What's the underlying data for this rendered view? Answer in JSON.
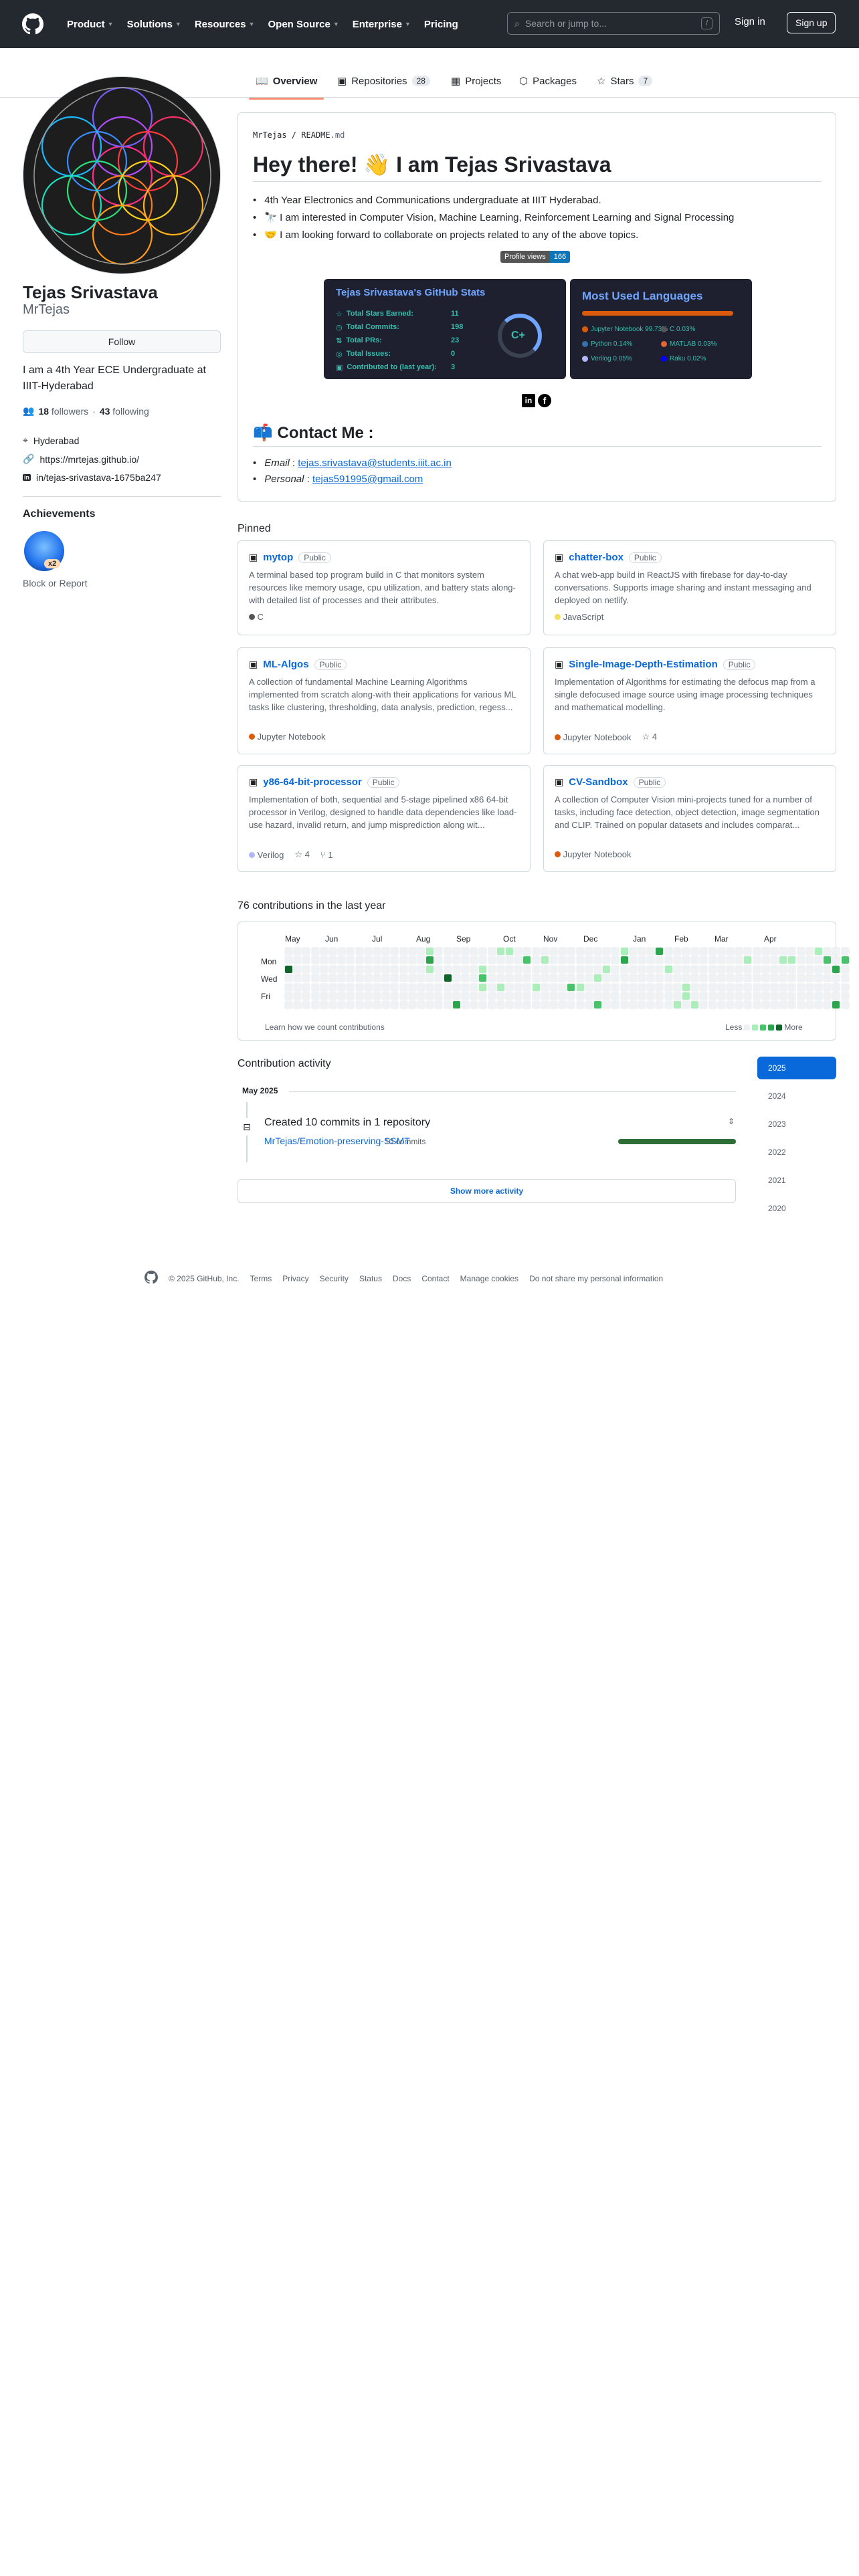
{
  "header": {
    "nav": [
      "Product",
      "Solutions",
      "Resources",
      "Open Source",
      "Enterprise",
      "Pricing"
    ],
    "search_placeholder": "Search or jump to...",
    "search_shortcut": "/",
    "signin": "Sign in",
    "signup": "Sign up"
  },
  "tabs": [
    {
      "label": "Overview",
      "icon": "book-icon"
    },
    {
      "label": "Repositories",
      "count": "28",
      "icon": "repo-icon"
    },
    {
      "label": "Projects",
      "icon": "table-icon"
    },
    {
      "label": "Packages",
      "icon": "package-icon"
    },
    {
      "label": "Stars",
      "count": "7",
      "icon": "star-icon"
    }
  ],
  "profile": {
    "name": "Tejas Srivastava",
    "login": "MrTejas",
    "follow": "Follow",
    "bio": "I am a 4th Year ECE Undergraduate at IIIT-Hyderabad",
    "followers": "18",
    "followers_label": "followers",
    "following": "43",
    "following_label": "following",
    "location": "Hyderabad",
    "website": "https://mrtejas.github.io/",
    "linkedin": "in/tejas-srivastava-1675ba247",
    "achievements_title": "Achievements",
    "achievement_count": "x2",
    "block": "Block or Report"
  },
  "readme": {
    "path_user": "MrTejas",
    "path_file": "README",
    "path_ext": ".md",
    "title": "Hey there! 👋 I am Tejas Srivastava",
    "bullets": [
      "4th Year Electronics and Communications undergraduate at IIIT Hyderabad.",
      "🔭 I am interested in Computer Vision, Machine Learning, Reinforcement Learning and Signal Processing",
      "🤝 I am looking forward to collaborate on projects related to any of the above topics."
    ],
    "profile_views_label": "Profile views",
    "profile_views": "166",
    "stats": {
      "title": "Tejas Srivastava's GitHub Stats",
      "rows": [
        {
          "label": "Total Stars Earned:",
          "value": "11"
        },
        {
          "label": "Total Commits:",
          "value": "198"
        },
        {
          "label": "Total PRs:",
          "value": "23"
        },
        {
          "label": "Total Issues:",
          "value": "0"
        },
        {
          "label": "Contributed to (last year):",
          "value": "3"
        }
      ],
      "grade": "C+"
    },
    "langs": {
      "title": "Most Used Languages",
      "items": [
        {
          "name": "Jupyter Notebook 99.73%",
          "color": "#DA5B0B"
        },
        {
          "name": "C 0.03%",
          "color": "#555555"
        },
        {
          "name": "Python 0.14%",
          "color": "#3572A5"
        },
        {
          "name": "MATLAB 0.03%",
          "color": "#e16737"
        },
        {
          "name": "Verilog 0.05%",
          "color": "#b2b7f8"
        },
        {
          "name": "Raku 0.02%",
          "color": "#0000fb"
        }
      ]
    },
    "contact_title": "📫 Contact Me :",
    "email_label": "Email",
    "email": "tejas.srivastava@students.iiit.ac.in",
    "personal_label": "Personal",
    "personal": "tejas591995@gmail.com"
  },
  "pinned": {
    "title": "Pinned",
    "public": "Public",
    "repos": [
      {
        "name": "mytop",
        "desc": "A terminal based top program build in C that monitors system resources like memory usage, cpu utilization, and battery stats along-with detailed list of processes and their attributes.",
        "lang": "C",
        "color": "#555555",
        "stars": "",
        "forks": ""
      },
      {
        "name": "chatter-box",
        "desc": "A chat web-app build in ReactJS with firebase for day-to-day conversations. Supports image sharing and instant messaging and deployed on netlify.",
        "lang": "JavaScript",
        "color": "#f1e05a",
        "stars": "",
        "forks": ""
      },
      {
        "name": "ML-Algos",
        "desc": "A collection of fundamental Machine Learning Algorithms implemented from scratch along-with their applications for various ML tasks like clustering, thresholding, data analysis, prediction, regess...",
        "lang": "Jupyter Notebook",
        "color": "#DA5B0B",
        "stars": "",
        "forks": ""
      },
      {
        "name": "Single-Image-Depth-Estimation",
        "desc": "Implementation of Algorithms for estimating the defocus map from a single defocused image source using image processing techniques and mathematical modelling.",
        "lang": "Jupyter Notebook",
        "color": "#DA5B0B",
        "stars": "4",
        "forks": ""
      },
      {
        "name": "y86-64-bit-processor",
        "desc": "Implementation of both, sequential and 5-stage pipelined x86 64-bit processor in Verilog, designed to handle data dependencies like load-use hazard, invalid return, and jump misprediction along wit...",
        "lang": "Verilog",
        "color": "#b2b7f8",
        "stars": "4",
        "forks": "1"
      },
      {
        "name": "CV-Sandbox",
        "desc": "A collection of Computer Vision mini-projects tuned for a number of tasks, including face detection, object detection, image segmentation and CLIP. Trained on popular datasets and includes comparat...",
        "lang": "Jupyter Notebook",
        "color": "#DA5B0B",
        "stars": "",
        "forks": ""
      }
    ]
  },
  "contributions": {
    "title": "76 contributions in the last year",
    "months": [
      "May",
      "Jun",
      "Jul",
      "Aug",
      "Sep",
      "Oct",
      "Nov",
      "Dec",
      "Jan",
      "Feb",
      "Mar",
      "Apr"
    ],
    "days": [
      "Mon",
      "Wed",
      "Fri"
    ],
    "learn": "Learn how we count contributions",
    "less": "Less",
    "more": "More",
    "colors": [
      "#eff2f5",
      "#aceebb",
      "#4ac26b",
      "#2da44e",
      "#116329"
    ]
  },
  "activity": {
    "title": "Contribution activity",
    "month": "May 2025",
    "event_title": "Created 10 commits in 1 repository",
    "repo": "MrTejas/Emotion-preserving-SSMT",
    "commits": "10 commits",
    "show_more": "Show more activity",
    "years": [
      "2025",
      "2024",
      "2023",
      "2022",
      "2021",
      "2020"
    ]
  },
  "footer": {
    "copyright": "© 2025 GitHub, Inc.",
    "links": [
      "Terms",
      "Privacy",
      "Security",
      "Status",
      "Docs",
      "Contact",
      "Manage cookies",
      "Do not share my personal information"
    ]
  }
}
